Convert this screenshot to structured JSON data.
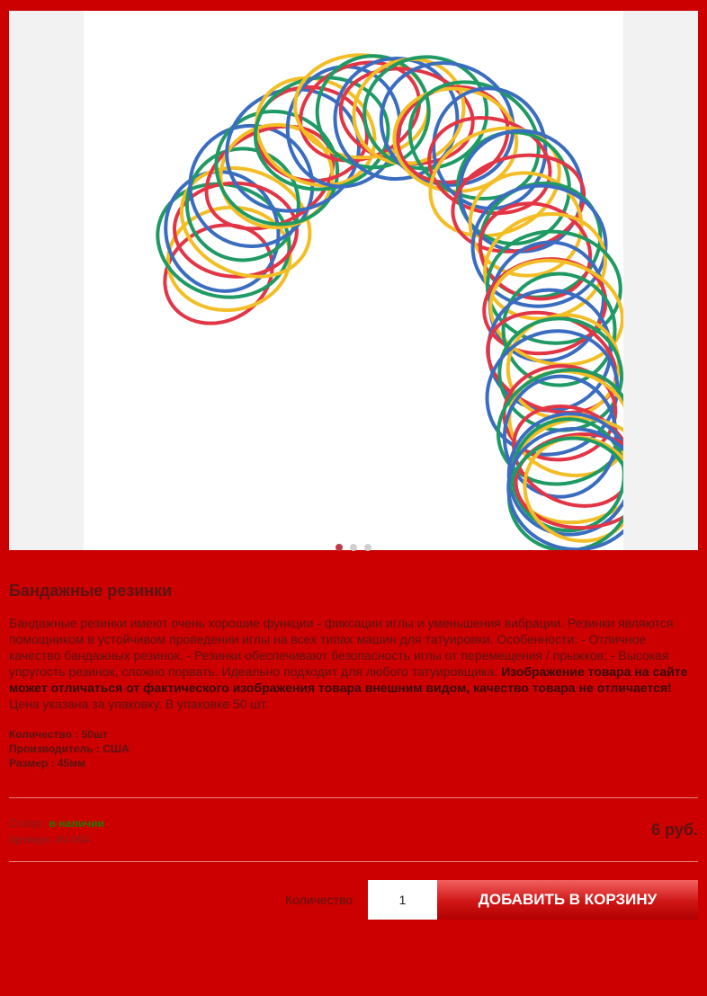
{
  "product": {
    "title": "Бандажные резинки",
    "description": "Бандажные резинки имеют очень хорошие функции - фиксации иглы и уменьшения вибрации. Резинки являются помощником в устойчивом проведении иглы на всех типах машин для татуировки. Особенности: - Отличное качество бандажных резинок. - Резинки обеспечивают безопасность иглы от перемещения / прыжков; - Высокая упругость резинок, сложно порвать. Идеально подходит для любого татуировщика.",
    "warning": "Изображение товара на сайте может отличаться от фактического изображения товара внешним видом, качество товара не отличается!",
    "note": "Цена указана за упаковку. В упаковке 50 шт.",
    "specs": [
      "Количество : 50шт",
      "Производитель : США",
      "Размер : 45мм"
    ],
    "status_label": "Статус:",
    "status_value": "в наличии",
    "sku": "Артикул: AV-004",
    "price": "6 руб."
  },
  "gallery": {
    "slide_count": 3,
    "active_slide": 1,
    "image": "rubber-bands-photo"
  },
  "cart": {
    "qty_label": "Количество",
    "qty_value": "1",
    "add_button": "ДОБАВИТЬ В КОРЗИНУ"
  },
  "colors": {
    "background": "#cc0000",
    "ring_colors": [
      "#e23545",
      "#f3be25",
      "#1f9a64",
      "#3a6dc0"
    ]
  }
}
